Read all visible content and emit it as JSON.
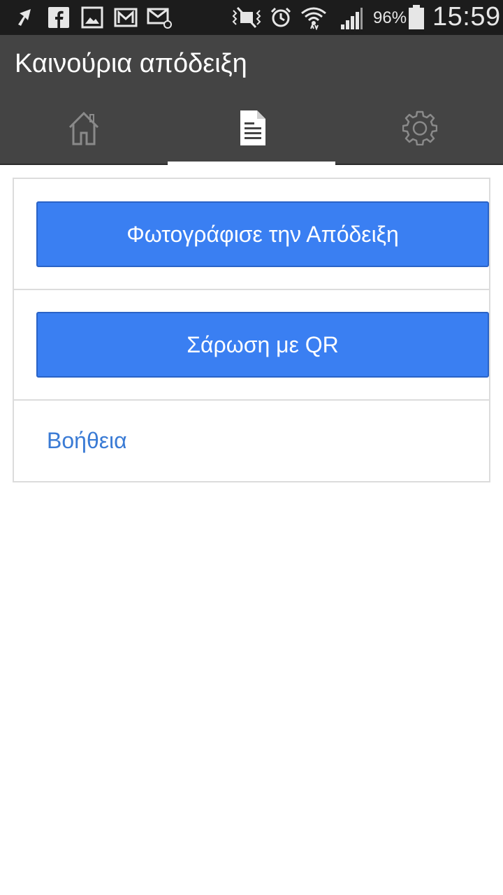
{
  "status_bar": {
    "icons": [
      "notification-icon",
      "facebook-icon",
      "gallery-icon",
      "gmail-icon",
      "email-icon",
      "mute-icon",
      "alarm-icon",
      "wifi-icon",
      "signal-icon",
      "battery-icon"
    ],
    "battery_percent": "96%",
    "time": "15:59"
  },
  "action_bar": {
    "title": "Καινούρια απόδειξη",
    "tabs": [
      {
        "icon": "home-icon",
        "selected": false
      },
      {
        "icon": "document-icon",
        "selected": true
      },
      {
        "icon": "gear-icon",
        "selected": false
      }
    ]
  },
  "main": {
    "photo_button_label": "Φωτογράφισε την Απόδειξη",
    "qr_button_label": "Σάρωση με QR",
    "help_link": "Βοήθεια"
  },
  "colors": {
    "status_bar_bg": "#1c1c1c",
    "action_bar_bg": "#444444",
    "button_bg": "#3a7ff2",
    "link": "#3a7bd5"
  }
}
